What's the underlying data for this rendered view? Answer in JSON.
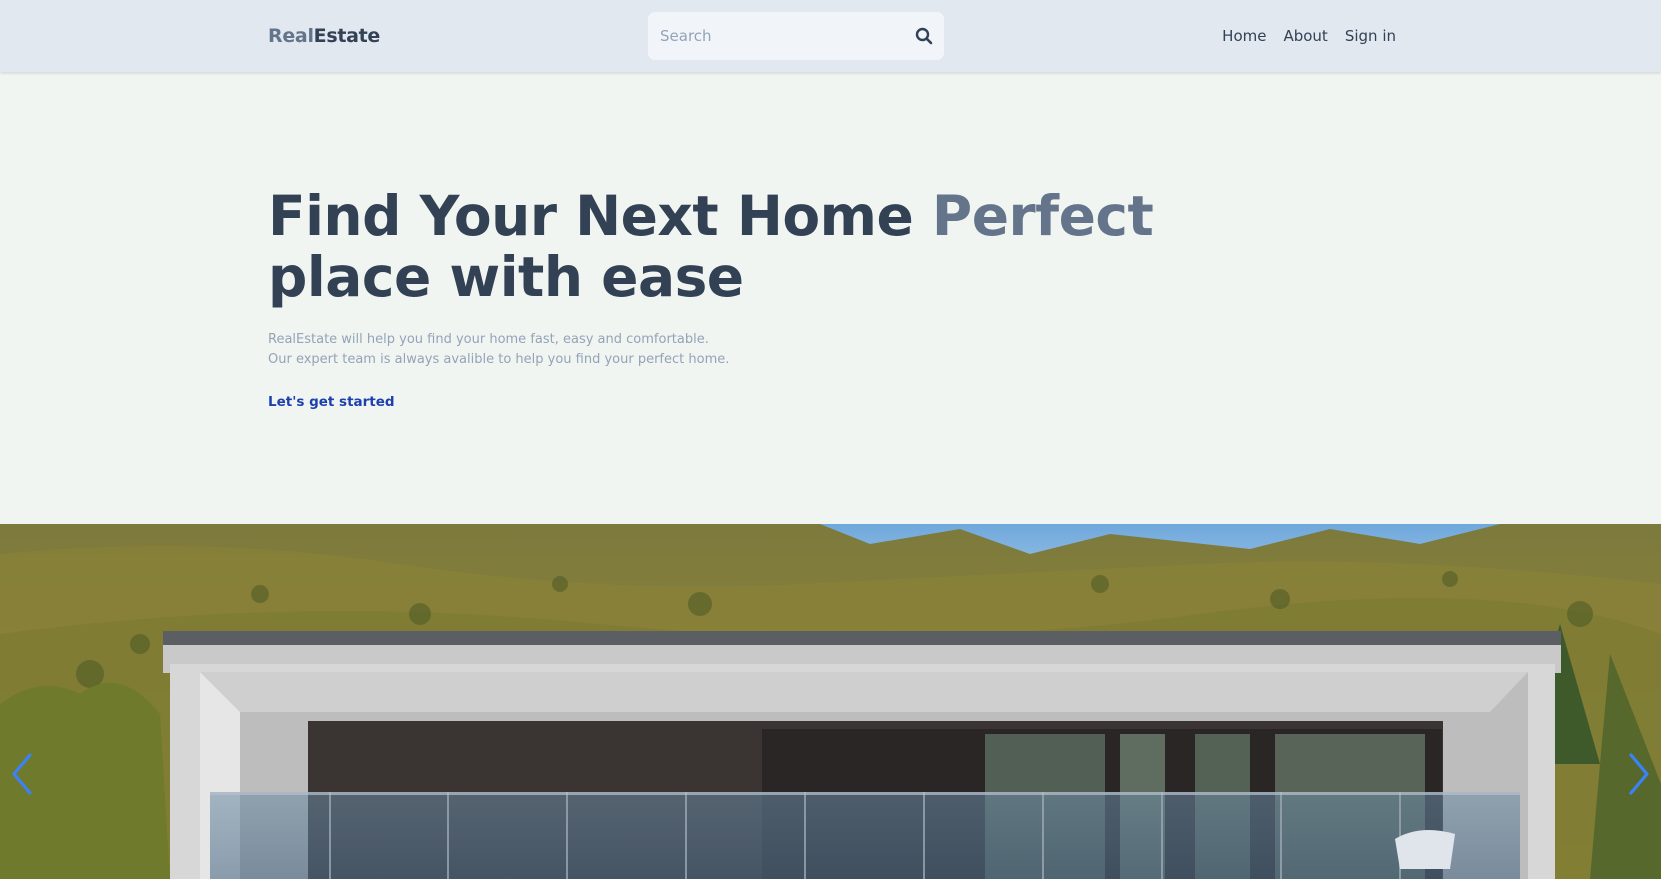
{
  "header": {
    "brand_part1": "Real",
    "brand_part2": "Estate",
    "search_placeholder": "Search",
    "nav": [
      "Home",
      "About",
      "Sign in"
    ]
  },
  "hero": {
    "title_main": "Find Your Next Home ",
    "title_accent": "Perfect",
    "title_line2": "place with ease",
    "desc_line1": "RealEstate will help you find your home fast, easy and comfortable.",
    "desc_line2": "Our expert team is always avalible to help you find your perfect home.",
    "cta": "Let's get started"
  },
  "slider": {
    "image_icon": "house-photo",
    "prev_icon": "chevron-left-icon",
    "next_icon": "chevron-right-icon"
  },
  "colors": {
    "navbar_bg": "#e2e8f0",
    "page_bg": "#f1f5f1",
    "text_dark": "#334155",
    "text_accent": "#64748b",
    "link": "#1e40af",
    "arrow": "#3b82f6"
  }
}
